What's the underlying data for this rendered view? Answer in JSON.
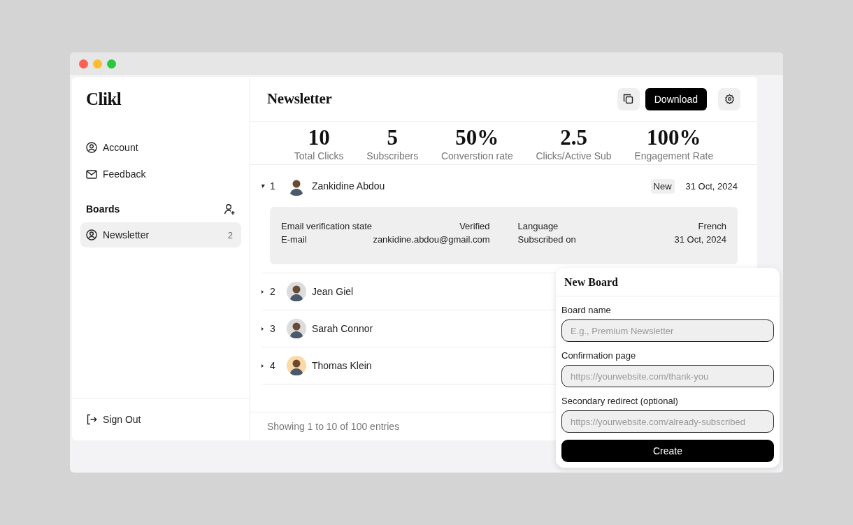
{
  "window": {
    "controls": [
      {
        "color": "#ff5f57"
      },
      {
        "color": "#febc2e"
      },
      {
        "color": "#28c840"
      }
    ]
  },
  "sidebar": {
    "logo": "Clikl",
    "items": [
      {
        "label": "Account"
      },
      {
        "label": "Feedback"
      }
    ],
    "boards_heading": "Boards",
    "boards": [
      {
        "label": "Newsletter",
        "count": "2",
        "selected": true
      }
    ],
    "sign_out": "Sign Out"
  },
  "header": {
    "title": "Newsletter",
    "download": "Download"
  },
  "stats": [
    {
      "value": "10",
      "label": "Total Clicks"
    },
    {
      "value": "5",
      "label": "Subscribers"
    },
    {
      "value": "50%",
      "label": "Converstion rate"
    },
    {
      "value": "2.5",
      "label": "Clicks/Active Sub"
    },
    {
      "value": "100%",
      "label": "Engagement Rate"
    }
  ],
  "rows": [
    {
      "index": "1",
      "name": "Zankidine Abdou",
      "badge": "New",
      "date": "31 Oct, 2024",
      "expanded": true,
      "details": [
        {
          "label": "Email verification state",
          "value": "Verified"
        },
        {
          "label": "Language",
          "value": "French"
        },
        {
          "label": "E-mail",
          "value": "zankidine.abdou@gmail.com"
        },
        {
          "label": "Subscribed on",
          "value": "31 Oct, 2024"
        }
      ]
    },
    {
      "index": "2",
      "name": "Jean Giel",
      "expanded": false
    },
    {
      "index": "3",
      "name": "Sarah Connor",
      "expanded": false
    },
    {
      "index": "4",
      "name": "Thomas Klein",
      "expanded": false
    }
  ],
  "footer": "Showing 1 to 10 of 100 entries",
  "popover": {
    "title": "New Board",
    "fields": [
      {
        "label": "Board name",
        "placeholder": "E.g., Premium Newsletter"
      },
      {
        "label": "Confirmation page",
        "placeholder": "https://yourwebsite.com/thank-you"
      },
      {
        "label": "Secondary redirect (optional)",
        "placeholder": "https://yourwebsite.com/already-subscribed"
      }
    ],
    "button": "Create"
  }
}
